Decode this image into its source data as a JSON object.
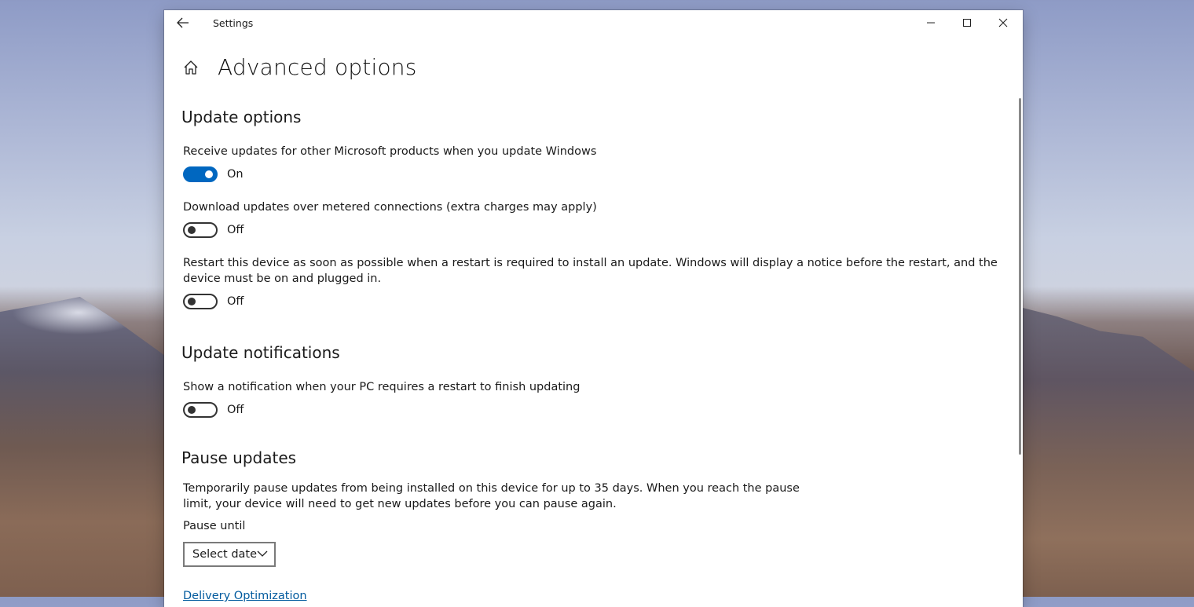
{
  "window": {
    "title": "Settings",
    "controls": [
      "minimize-icon",
      "maximize-icon",
      "close-icon"
    ]
  },
  "page": {
    "title": "Advanced options"
  },
  "sections": {
    "update_options": {
      "heading": "Update options",
      "settings": [
        {
          "label": "Receive updates for other Microsoft products when you update Windows",
          "state": "On",
          "on": true
        },
        {
          "label": "Download updates over metered connections (extra charges may apply)",
          "state": "Off",
          "on": false
        },
        {
          "label": "Restart this device as soon as possible when a restart is required to install an update. Windows will display a notice before the restart, and the device must be on and plugged in.",
          "state": "Off",
          "on": false
        }
      ]
    },
    "update_notifications": {
      "heading": "Update notifications",
      "settings": [
        {
          "label": "Show a notification when your PC requires a restart to finish updating",
          "state": "Off",
          "on": false
        }
      ]
    },
    "pause_updates": {
      "heading": "Pause updates",
      "description": "Temporarily pause updates from being installed on this device for up to 35 days. When you reach the pause limit, your device will need to get new updates before you can pause again.",
      "pause_until_label": "Pause until",
      "select_value": "Select date"
    }
  },
  "links": {
    "delivery_optimization": "Delivery Optimization"
  },
  "colors": {
    "accent": "#0067c0",
    "link": "#005a9e"
  }
}
